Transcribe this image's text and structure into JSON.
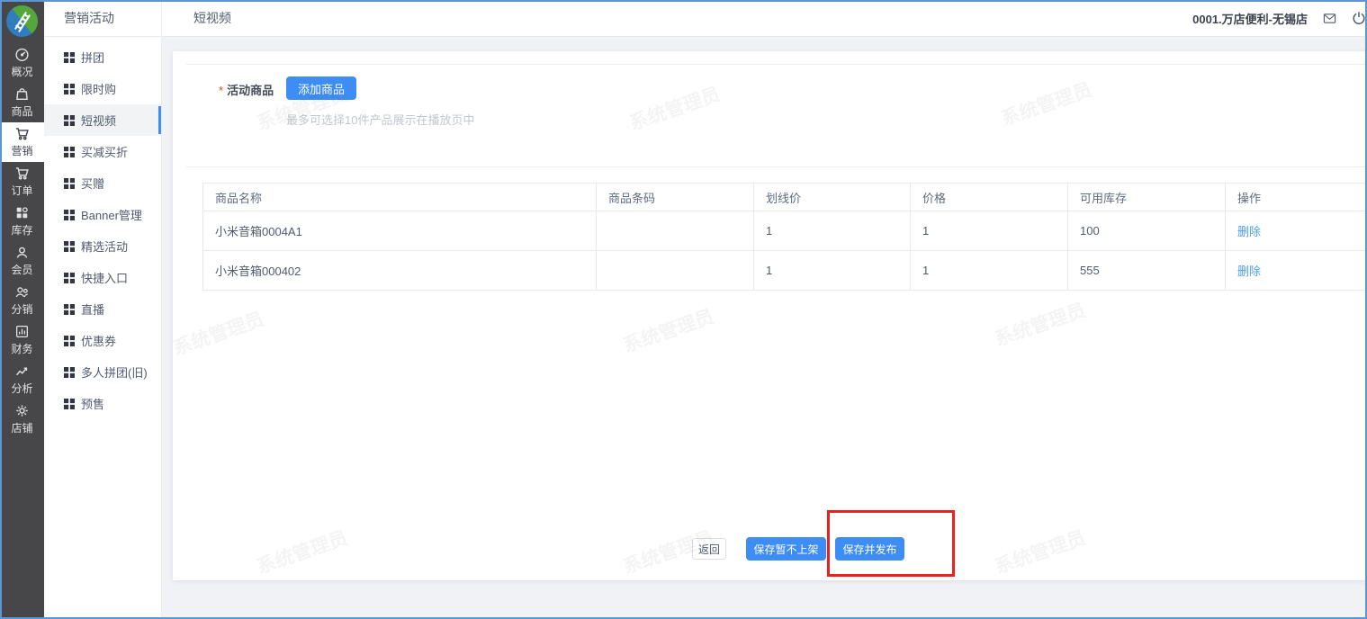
{
  "header": {
    "page_title": "短视频",
    "store_name": "0001.万店便利-无锡店"
  },
  "primary_nav": {
    "items": [
      {
        "label": "概况",
        "icon": "dashboard-icon",
        "active": false
      },
      {
        "label": "商品",
        "icon": "goods-icon",
        "active": false
      },
      {
        "label": "营销",
        "icon": "marketing-cart-icon",
        "active": true
      },
      {
        "label": "订单",
        "icon": "order-cart-icon",
        "active": false
      },
      {
        "label": "库存",
        "icon": "inventory-icon",
        "active": false
      },
      {
        "label": "会员",
        "icon": "member-icon",
        "active": false
      },
      {
        "label": "分销",
        "icon": "distribution-icon",
        "active": false
      },
      {
        "label": "财务",
        "icon": "finance-icon",
        "active": false
      },
      {
        "label": "分析",
        "icon": "analysis-icon",
        "active": false
      },
      {
        "label": "店铺",
        "icon": "shop-gear-icon",
        "active": false
      }
    ]
  },
  "secondary_nav": {
    "title": "营销活动",
    "items": [
      {
        "label": "拼团",
        "active": false
      },
      {
        "label": "限时购",
        "active": false
      },
      {
        "label": "短视频",
        "active": true
      },
      {
        "label": "买减买折",
        "active": false
      },
      {
        "label": "买赠",
        "active": false
      },
      {
        "label": "Banner管理",
        "active": false
      },
      {
        "label": "精选活动",
        "active": false
      },
      {
        "label": "快捷入口",
        "active": false
      },
      {
        "label": "直播",
        "active": false
      },
      {
        "label": "优惠券",
        "active": false
      },
      {
        "label": "多人拼团(旧)",
        "active": false
      },
      {
        "label": "预售",
        "active": false
      }
    ]
  },
  "form": {
    "required_mark": "*",
    "label": "活动商品",
    "add_button": "添加商品",
    "hint": "最多可选择10件产品展示在播放页中"
  },
  "table": {
    "columns": [
      "商品名称",
      "商品条码",
      "划线价",
      "价格",
      "可用库存",
      "操作"
    ],
    "rows": [
      {
        "name": "小米音箱0004A1",
        "barcode": "",
        "line_price": "1",
        "price": "1",
        "stock": "100",
        "action": "删除"
      },
      {
        "name": "小米音箱000402",
        "barcode": "",
        "line_price": "1",
        "price": "1",
        "stock": "555",
        "action": "删除"
      }
    ]
  },
  "footer": {
    "back_button": "返回",
    "save_draft_button": "保存暂不上架",
    "save_publish_button": "保存并发布"
  },
  "watermark": {
    "text": "系统管理员"
  },
  "colors": {
    "primary_blue": "#3d8df5",
    "link_blue": "#4d9ef5",
    "sidebar_dark": "#47474a",
    "annotation_red": "#ee1f1f",
    "screenshot_border_blue": "#5b97d5"
  }
}
